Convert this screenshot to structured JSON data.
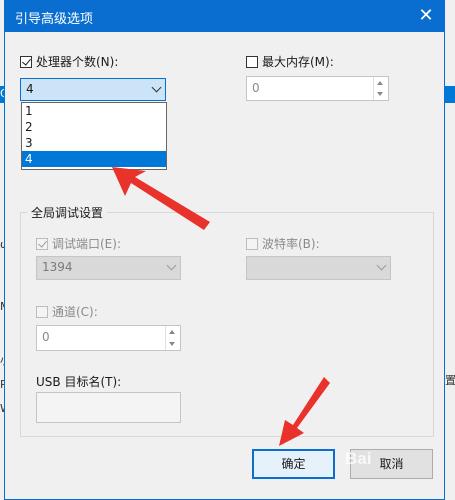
{
  "background": {
    "left_texts": [
      "Q",
      "ω",
      "M",
      "小",
      "P",
      "W"
    ],
    "right_texts": [
      "置"
    ]
  },
  "dialog": {
    "title": "引导高级选项",
    "close_glyph": "✕"
  },
  "processors": {
    "label": "处理器个数(N):",
    "checked": true,
    "selected": "4",
    "options": [
      "1",
      "2",
      "3",
      "4"
    ]
  },
  "max_memory": {
    "label": "最大内存(M):",
    "checked": false,
    "value": "0"
  },
  "debug_group": {
    "title": "全局调试设置",
    "debug_port_label": "调试端口(E):",
    "debug_port_checked": true,
    "debug_port_value": "1394",
    "baud_label": "波特率(B):",
    "baud_checked": false,
    "baud_value": "",
    "channel_label": "通道(C):",
    "channel_checked": false,
    "channel_value": "0",
    "usb_label": "USB 目标名(T):",
    "usb_value": ""
  },
  "buttons": {
    "ok": "确定",
    "cancel": "取消"
  },
  "watermark": "Bai",
  "colors": {
    "accent": "#0a6ed1",
    "annotation": "#e8322b"
  }
}
